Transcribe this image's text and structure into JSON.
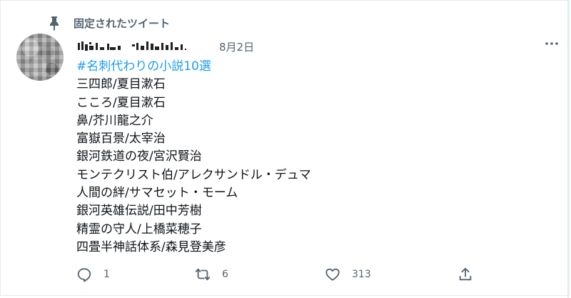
{
  "pinned": {
    "label": "固定されたツイート",
    "icon": "pin-icon"
  },
  "author": {
    "name_display": "",
    "date": "8月2日"
  },
  "tweet": {
    "hashtag": "#名刺代わりの小説10選",
    "lines": [
      "三四郎/夏目漱石",
      "こころ/夏目漱石",
      "鼻/芥川龍之介",
      "富嶽百景/太宰治",
      "銀河鉄道の夜/宮沢賢治",
      "モンテクリスト伯/アレクサンドル・デュマ",
      "人間の絆/サマセット・モーム",
      "銀河英雄伝説/田中芳樹",
      "精霊の守人/上橋菜穂子",
      "四畳半神話体系/森見登美彦"
    ]
  },
  "actions": {
    "reply_count": "1",
    "retweet_count": "6",
    "like_count": "313"
  },
  "colors": {
    "accent": "#1d9bf0",
    "secondary_text": "#536471",
    "primary_text": "#0f1419"
  }
}
